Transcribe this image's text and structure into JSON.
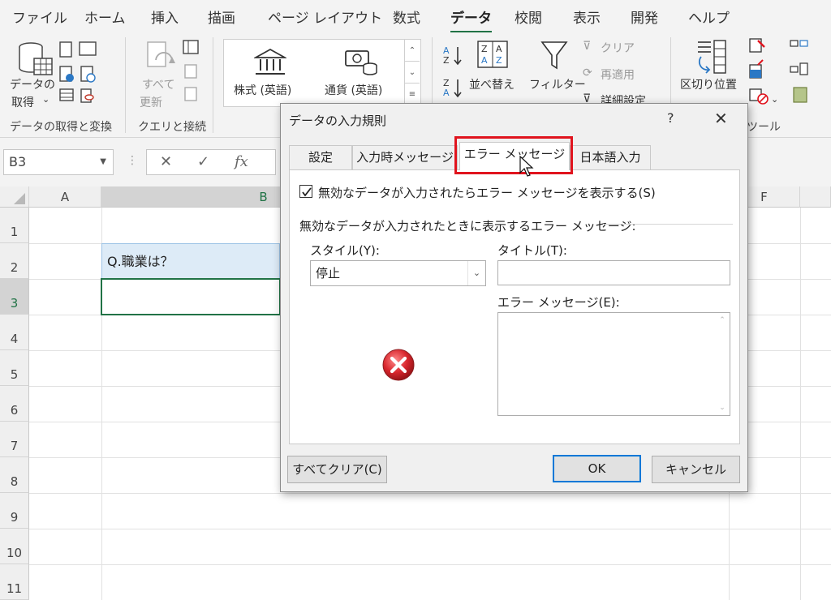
{
  "ribbon_tabs": [
    "ファイル",
    "ホーム",
    "挿入",
    "描画",
    "ページ レイアウト",
    "数式",
    "データ",
    "校閲",
    "表示",
    "開発",
    "ヘルプ"
  ],
  "active_tab": "データ",
  "ribbon": {
    "get_data_label_1": "データの",
    "get_data_label_2": "取得",
    "group_get_transform": "データの取得と変換",
    "refresh_all_1": "すべて",
    "refresh_all_2": "更新",
    "group_queries": "クエリと接続",
    "stocks": "株式 (英語)",
    "currencies": "通貨 (英語)",
    "sort": "並べ替え",
    "filter": "フィルター",
    "clear": "クリア",
    "reapply": "再適用",
    "advanced": "詳細設定",
    "text_to_columns": "区切り位置",
    "group_tools": "ツール"
  },
  "formula_bar": {
    "name_box": "B3",
    "cancel": "✕",
    "enter": "✓",
    "fx": "fx"
  },
  "sheet": {
    "columns": [
      "A",
      "B",
      "F"
    ],
    "rows": [
      "1",
      "2",
      "3",
      "4",
      "5",
      "6",
      "7",
      "8",
      "9",
      "10",
      "11"
    ],
    "cell_B2": "Q.職業は？"
  },
  "dialog": {
    "title": "データの入力規則",
    "help": "?",
    "close": "✕",
    "tabs": [
      "設定",
      "入力時メッセージ",
      "エラー メッセージ",
      "日本語入力"
    ],
    "active_tab_index": 2,
    "show_error_checkbox": "無効なデータが入力されたらエラー メッセージを表示する(S)",
    "show_error_checked": true,
    "section_label": "無効なデータが入力されたときに表示するエラー メッセージ:",
    "style_label": "スタイル(Y):",
    "style_value": "停止",
    "title_label": "タイトル(T):",
    "title_value": "",
    "error_message_label": "エラー メッセージ(E):",
    "error_message_value": "",
    "clear_all_button": "すべてクリア(C)",
    "ok_button": "OK",
    "cancel_button": "キャンセル"
  },
  "colors": {
    "excel_green": "#217346",
    "highlight_red": "#e0141e",
    "cell_fill": "#ddebf7",
    "ok_border": "#0078d7"
  }
}
